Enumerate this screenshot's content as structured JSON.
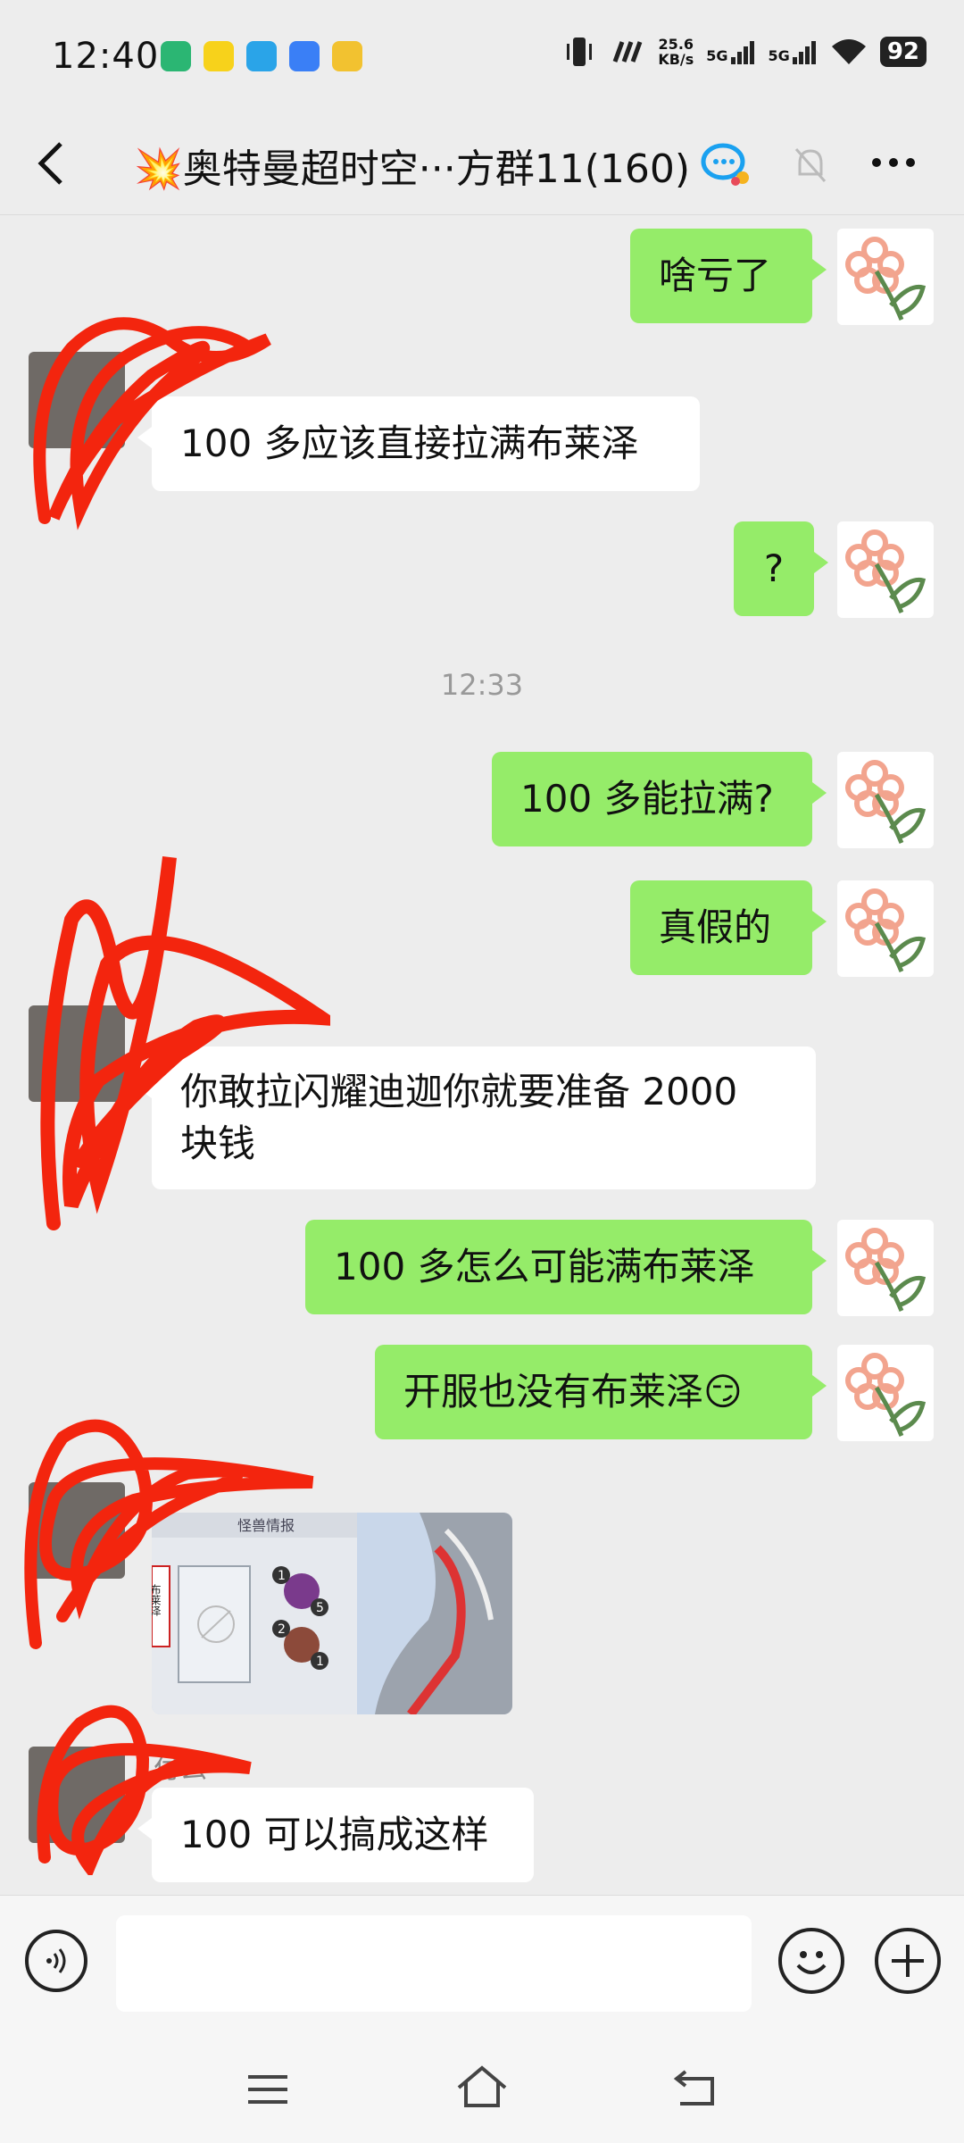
{
  "status_bar": {
    "time": "12:40",
    "app_icons": [
      {
        "icon": "reading-app-icon",
        "color": "#2bb673"
      },
      {
        "icon": "novel-app-icon",
        "color": "#f7d21b"
      },
      {
        "icon": "telegram-icon",
        "color": "#2aa4e8"
      },
      {
        "icon": "browser-icon",
        "color": "#3a7ff6"
      },
      {
        "icon": "files-icon",
        "color": "#f2c230"
      }
    ],
    "net_speed_value": "25.6",
    "net_speed_unit": "KB/s",
    "signal_1": "5G",
    "signal_2": "5G",
    "battery": "92"
  },
  "header": {
    "title": "💥奥特曼超时空···方群11(160)",
    "back_icon": "back-arrow-icon",
    "group_icon": "group-chat-icon",
    "mute_icon": "bell-muted-icon",
    "more_icon": "more-dots-icon"
  },
  "messages": {
    "m1": "啥亏了",
    "m2": "100 多应该直接拉满布莱泽",
    "m3": "?",
    "time_divider": "12:33",
    "m4": "100 多能拉满?",
    "m5": "真假的",
    "m6_line1": "你敢拉闪耀迪迦你就要准备 2000",
    "m6_line2": "块钱",
    "m7": "100 多怎么可能满布莱泽",
    "m8": "开服也没有布莱泽😏",
    "sticker_header": "怪兽情报",
    "sticker_side_text": "布莱泽",
    "sticker_badges": [
      "1",
      "5",
      "2",
      "1"
    ],
    "sender_name_partial": "付么",
    "m9": "100 可以搞成这样"
  },
  "composer": {
    "placeholder": "",
    "voice_icon": "voice-icon",
    "emoji_icon": "emoji-icon",
    "plus_icon": "plus-icon"
  },
  "nav_bar": {
    "menu_icon": "menu-icon",
    "home_icon": "home-icon",
    "back_icon": "back-nav-icon"
  },
  "colors": {
    "chat_bg": "#ededed",
    "my_bubble": "#95ec69",
    "their_bubble": "#ffffff",
    "scribble": "#f3250e"
  }
}
